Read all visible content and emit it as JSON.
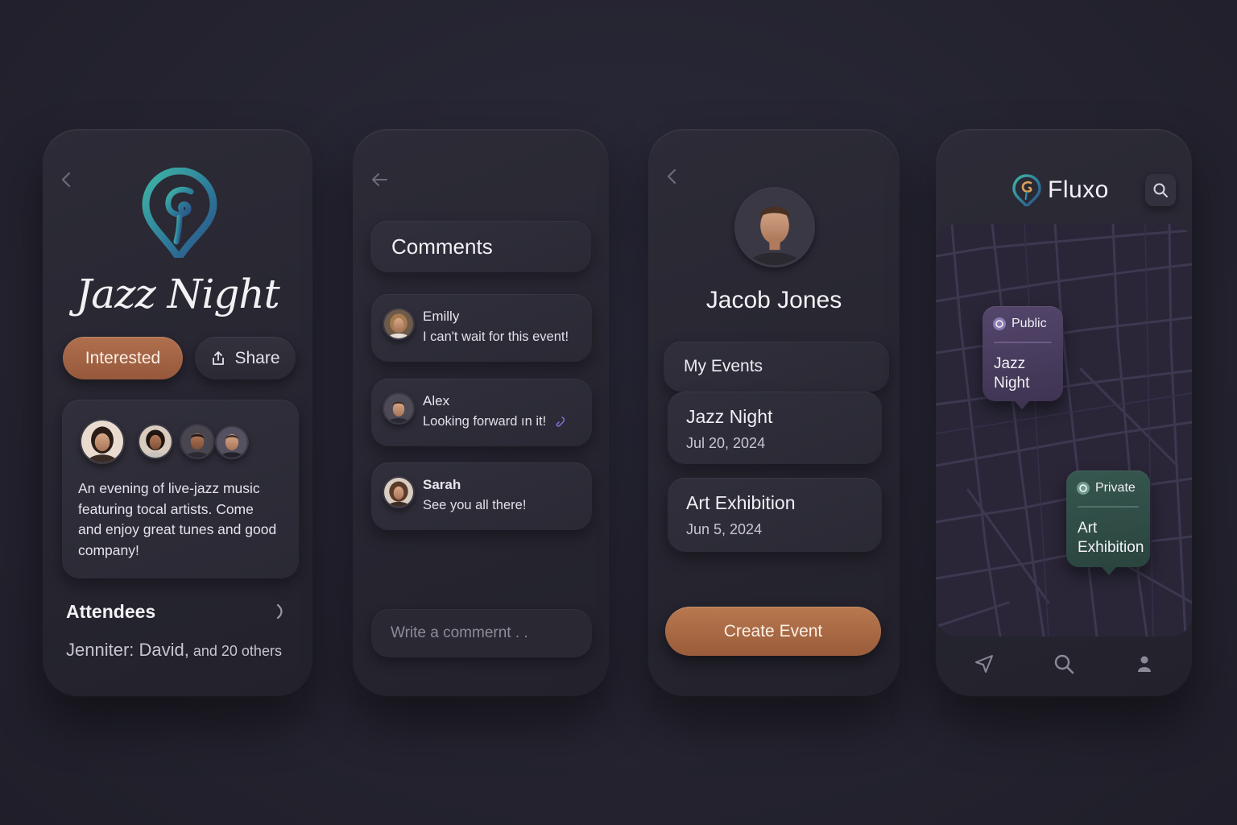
{
  "event": {
    "title": "Jazz Night",
    "interested_label": "Interested",
    "share_label": "Share",
    "description": "An evening of live-jazz music featuring tocal artists. Come and enjoy great tunes and good company!",
    "attendees_title": "Attendees",
    "attendees_names": "Jenniter:  David,",
    "attendees_more": " and 20 others"
  },
  "comments": {
    "title": "Comments",
    "items": [
      {
        "name": "Emilly",
        "text": "I can't wait for this event!"
      },
      {
        "name": "Alex",
        "text": "Looking forward ın it!"
      },
      {
        "name": "Sarah",
        "text": "See you all there!"
      }
    ],
    "input_placeholder": "Write a commernt . ."
  },
  "profile": {
    "name": "Jacob Jones",
    "tab_label": "My Events",
    "events": [
      {
        "title": "Jazz Night",
        "date": "Jul 20, 2024"
      },
      {
        "title": "Art Exhibition",
        "date": "Jun 5, 2024"
      }
    ],
    "create_label": "Create Event"
  },
  "map_screen": {
    "brand": "Fluxo",
    "pins": [
      {
        "tag": "Public",
        "title_line1": "Jazz",
        "title_line2": "Night",
        "color": "#4a3d5e"
      },
      {
        "tag": "Private",
        "title_line1": "Art",
        "title_line2": "Exhibition",
        "color": "#2e4a44"
      }
    ],
    "tabs": [
      "navigate-icon",
      "search-icon",
      "profile-icon"
    ]
  },
  "colors": {
    "accent": "#a8694a",
    "background": "#24232f",
    "card": "#2d2c37",
    "public_pin": "#4a3d5e",
    "private_pin": "#2e4a44"
  }
}
